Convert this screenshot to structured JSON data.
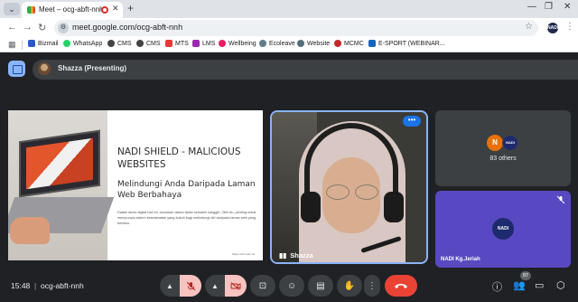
{
  "browser": {
    "tab_title": "Meet – ocg-abft-nnh",
    "url": "meet.google.com/ocg-abft-nnh",
    "ext_label": "NADI",
    "bookmarks": [
      "Bizmail",
      "WhatsApp",
      "CMS",
      "CMS",
      "MTS",
      "LMS",
      "Wellbeing",
      "Ecoleave",
      "Website",
      "MCMC",
      "E-SPORT (WEBINAR..."
    ]
  },
  "meet": {
    "presenter_label": "Shazza (Presenting)",
    "slide": {
      "title": "NADI SHIELD - MALICIOUS WEBSITES",
      "subtitle": "Melindungi Anda Daripada Laman Web Berbahaya",
      "body": "Dalam dunia digital hari ini, ancaman dalam talian semakin canggih. Oleh itu, penting untuk mempunyai sistem keselamatan yang kukuh bagi melindungi diri daripada laman web yang berisiko.",
      "footer": "Made with Gamma"
    },
    "speaker_name": "Shazza",
    "others_initial": "N",
    "others_logo": "NADI",
    "others_label": "83 others",
    "nadi_logo": "NADI",
    "nadi_label": "NADI Kg.Jeriah",
    "time": "15:48",
    "meeting_code": "ocg-abft-nnh",
    "people_count": "87"
  }
}
